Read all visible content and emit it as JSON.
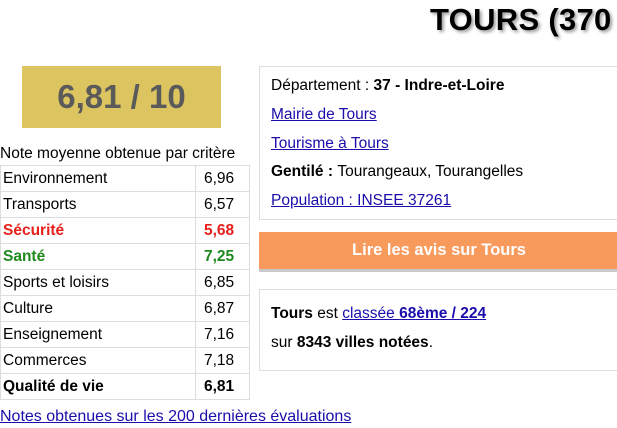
{
  "city": {
    "title": "TOURS (370"
  },
  "score": {
    "value": "6,81 / 10"
  },
  "criteria": {
    "caption": "Note moyenne obtenue par critère",
    "rows": [
      {
        "label": "Environnement",
        "value": "6,96"
      },
      {
        "label": "Transports",
        "value": "6,57"
      },
      {
        "label": "Sécurité",
        "value": "5,68"
      },
      {
        "label": "Santé",
        "value": "7,25"
      },
      {
        "label": "Sports et loisirs",
        "value": "6,85"
      },
      {
        "label": "Culture",
        "value": "6,87"
      },
      {
        "label": "Enseignement",
        "value": "7,16"
      },
      {
        "label": "Commerces",
        "value": "7,18"
      },
      {
        "label": "Qualité de vie",
        "value": "6,81"
      }
    ]
  },
  "notes_link": "Notes obtenues sur les 200 dernières évaluations",
  "info": {
    "departement_label": "Département : ",
    "departement_value": "37 - Indre-et-Loire",
    "mairie_link": "Mairie de Tours",
    "tourisme_link": "Tourisme à Tours",
    "gentile_label": "Gentilé : ",
    "gentile_value": "Tourangeaux, Tourangelles",
    "population_link": "Population : INSEE 37261"
  },
  "cta_label": "Lire les avis sur Tours",
  "ranking": {
    "city": "Tours",
    "est": " est ",
    "classee": "classée ",
    "rank": "68ème / 224",
    "sur": "sur ",
    "count": "8343 villes notées",
    "dot": "."
  },
  "colors": {
    "score_bg": "#dcc560",
    "cta_bg": "#f89a5c",
    "red": "#e8201b",
    "green": "#1e8a1e",
    "link": "#1a0dab"
  }
}
